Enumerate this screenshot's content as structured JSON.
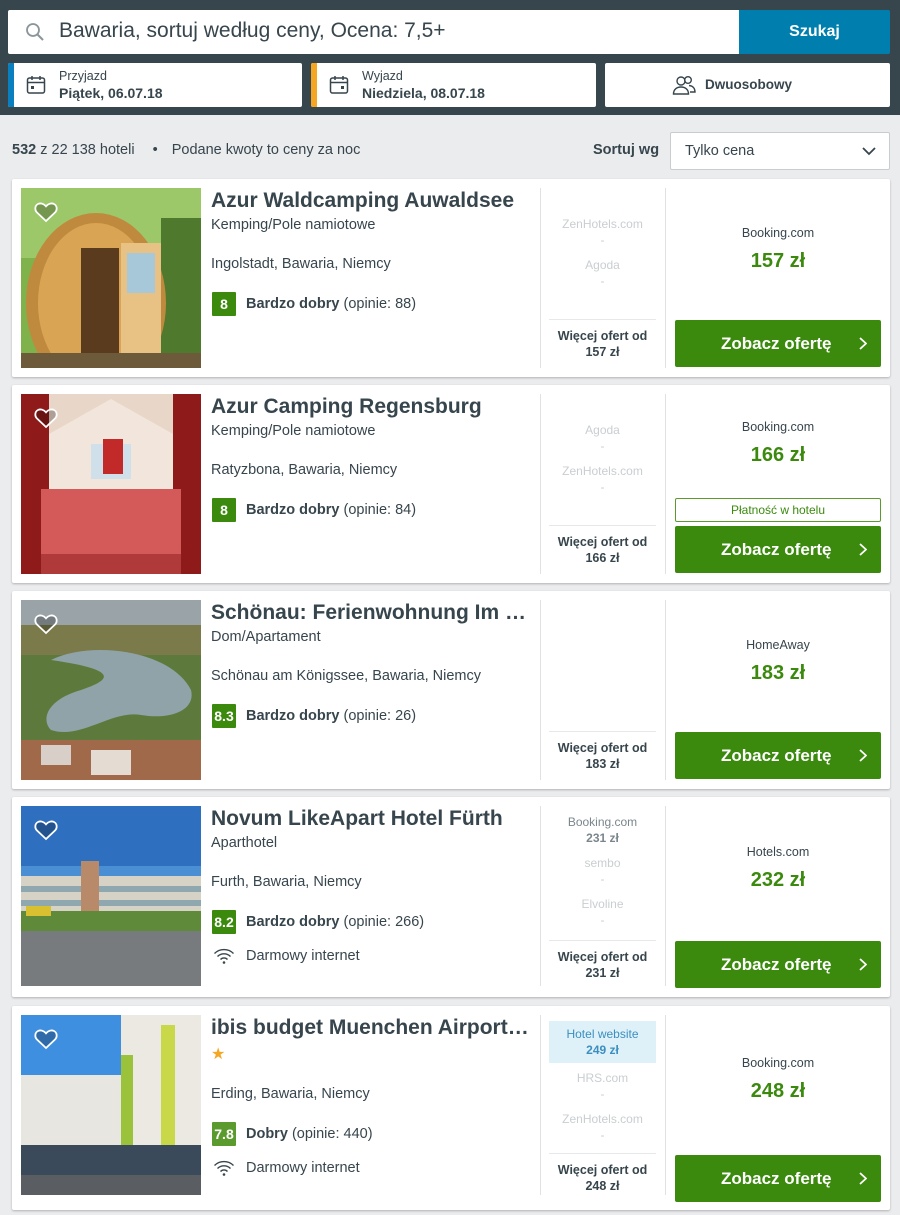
{
  "search": {
    "query": "Bawaria, sortuj według ceny, Ocena: 7,5+",
    "button": "Szukaj"
  },
  "checkin": {
    "label": "Przyjazd",
    "value": "Piątek, 06.07.18",
    "color": "#0a7fc0"
  },
  "checkout": {
    "label": "Wyjazd",
    "value": "Niedziela, 08.07.18",
    "color": "#f5a623"
  },
  "room": {
    "value": "Dwuosobowy"
  },
  "summary": {
    "count": "532",
    "rest": " z 22 138 hoteli",
    "dot": "•",
    "note": "Podane kwoty to ceny za noc"
  },
  "sort": {
    "label": "Sortuj wg",
    "value": "Tylko cena"
  },
  "offer_label": "Zobacz ofertę",
  "hotels": [
    {
      "name": "Azur Waldcamping Auwaldsee",
      "type": "Kemping/Pole namiotowe",
      "location": "Ingolstadt, Bawaria, Niemcy",
      "score": "8",
      "rating": "Bardzo dobry",
      "reviews": "(opinie: 88)",
      "others": [
        {
          "name": "ZenHotels.com",
          "price": "-"
        },
        {
          "name": "Agoda",
          "price": "-"
        }
      ],
      "more": "Więcej ofert od",
      "more_price": "157 zł",
      "provider": "Booking.com",
      "price": "157 zł"
    },
    {
      "name": "Azur Camping Regensburg",
      "type": "Kemping/Pole namiotowe",
      "location": "Ratyzbona, Bawaria, Niemcy",
      "score": "8",
      "rating": "Bardzo dobry",
      "reviews": "(opinie: 84)",
      "others": [
        {
          "name": "Agoda",
          "price": "-"
        },
        {
          "name": "ZenHotels.com",
          "price": "-"
        }
      ],
      "more": "Więcej ofert od",
      "more_price": "166 zł",
      "provider": "Booking.com",
      "price": "166 zł",
      "pay_at_hotel": "Płatność w hotelu"
    },
    {
      "name": "Schönau: Ferienwohnung Im Haus Sonnenschein",
      "type": "Dom/Apartament",
      "location": "Schönau am Königssee, Bawaria, Niemcy",
      "score": "8.3",
      "rating": "Bardzo dobry",
      "reviews": "(opinie: 26)",
      "others": [],
      "more": "Więcej ofert od",
      "more_price": "183 zł",
      "provider": "HomeAway",
      "price": "183 zł"
    },
    {
      "name": "Novum LikeApart Hotel Fürth",
      "type": "Aparthotel",
      "location": "Furth, Bawaria, Niemcy",
      "score": "8.2",
      "rating": "Bardzo dobry",
      "reviews": "(opinie: 266)",
      "wifi": "Darmowy internet",
      "others": [
        {
          "name": "Booking.com",
          "price": "231 zł"
        },
        {
          "name": "sembo",
          "price": "-"
        },
        {
          "name": "Elvoline",
          "price": "-"
        }
      ],
      "more": "Więcej ofert od",
      "more_price": "231 zł",
      "provider": "Hotels.com",
      "price": "232 zł"
    },
    {
      "name": "ibis budget Muenchen Airport Erding",
      "star": "★",
      "location": "Erding, Bawaria, Niemcy",
      "score": "7.8",
      "rating": "Dobry",
      "reviews": "(opinie: 440)",
      "wifi": "Darmowy internet",
      "others": [
        {
          "name": "Hotel website",
          "price": "249 zł"
        },
        {
          "name": "HRS.com",
          "price": "-"
        },
        {
          "name": "ZenHotels.com",
          "price": "-"
        }
      ],
      "more": "Więcej ofert od",
      "more_price": "248 zł",
      "provider": "Booking.com",
      "price": "248 zł"
    }
  ]
}
